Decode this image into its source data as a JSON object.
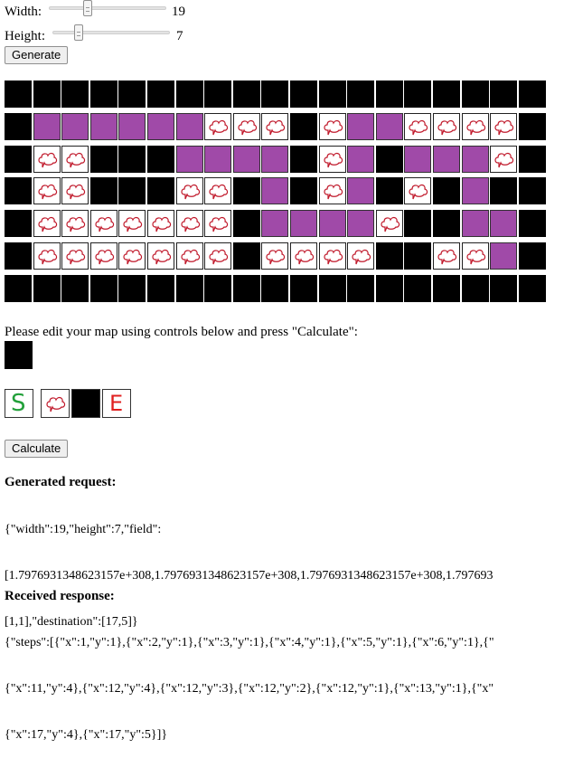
{
  "controls": {
    "width_label": "Width:",
    "width_value": "19",
    "width_fraction": 0.32,
    "height_label": "Height:",
    "height_value": "7",
    "height_fraction": 0.2,
    "generate_label": "Generate"
  },
  "map": {
    "legend": {
      "W": "wall",
      "P": "path",
      "C": "cloud"
    },
    "rows": [
      "WWWWWWWWWWWWWWWWWWW",
      "WPPPPPPCCCWCPPCCCCW",
      "WCCWWWPPPPWCPWPPPCW",
      "WCCWWWCCWPWCPWCWPWW",
      "WCCCCCCCWPPPPCWWPPW",
      "WCCCCCCCWCCCCWWCCPW",
      "WWWWWWWWWWWWWWWWWWW"
    ]
  },
  "instructions": "Please edit your map using controls below and press \"Calculate\":",
  "tools": [
    {
      "name": "start",
      "glyph": "S",
      "color": "#22a03a"
    },
    {
      "name": "cloud"
    },
    {
      "name": "wall"
    },
    {
      "name": "end",
      "glyph": "E",
      "color": "#e02020"
    }
  ],
  "calculate_label": "Calculate",
  "request": {
    "title": "Generated request:",
    "lines": [
      "{\"width\":19,\"height\":7,\"field\":",
      "[1.7976931348623157e+308,1.7976931348623157e+308,1.7976931348623157e+308,1.797693",
      "[1,1],\"destination\":[17,5]}"
    ]
  },
  "response": {
    "title": "Received response:",
    "lines": [
      "{\"steps\":[{\"x\":1,\"y\":1},{\"x\":2,\"y\":1},{\"x\":3,\"y\":1},{\"x\":4,\"y\":1},{\"x\":5,\"y\":1},{\"x\":6,\"y\":1},{\"",
      "{\"x\":11,\"y\":4},{\"x\":12,\"y\":4},{\"x\":12,\"y\":3},{\"x\":12,\"y\":2},{\"x\":12,\"y\":1},{\"x\":13,\"y\":1},{\"x\"",
      "{\"x\":17,\"y\":4},{\"x\":17,\"y\":5}]}"
    ]
  },
  "colors": {
    "path": "#a04aa8",
    "wall": "#000000",
    "cloud_stroke": "#c0182a"
  }
}
